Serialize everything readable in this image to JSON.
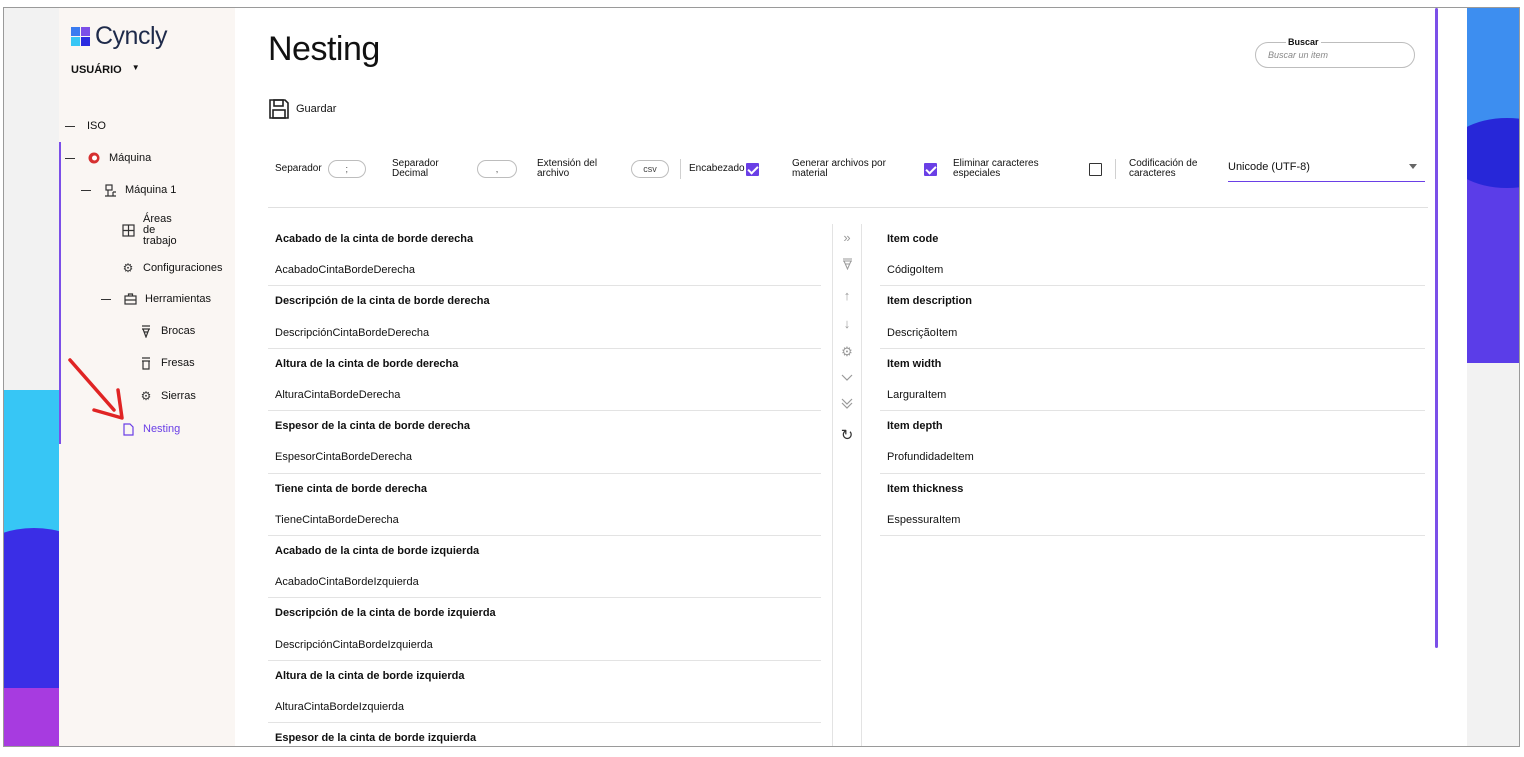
{
  "brand": {
    "name": "Cyncly"
  },
  "user": {
    "name": "USUÁRIO"
  },
  "sidebar": {
    "items": [
      {
        "label": "ISO",
        "icon": "dash"
      },
      {
        "label": "Máquina",
        "icon": "machine-logo-icon"
      },
      {
        "label": "Máquina 1",
        "icon": "machine-icon"
      },
      {
        "label": "Áreas de trabajo",
        "icon": "grid-icon"
      },
      {
        "label": "Configuraciones",
        "icon": "gear-icon"
      },
      {
        "label": "Herramientas",
        "icon": "toolbox-icon"
      },
      {
        "label": "Brocas",
        "icon": "drill-bit-icon"
      },
      {
        "label": "Fresas",
        "icon": "mill-icon"
      },
      {
        "label": "Sierras",
        "icon": "saw-icon"
      },
      {
        "label": "Nesting",
        "icon": "file-icon"
      }
    ]
  },
  "page": {
    "title": "Nesting"
  },
  "search": {
    "label": "Buscar",
    "placeholder": "Buscar un item"
  },
  "toolbar": {
    "save_label": "Guardar",
    "separator_label": "Separador",
    "separator_value": ";",
    "decimal_label_1": "Separador",
    "decimal_label_2": "Decimal",
    "decimal_value": ",",
    "ext_label_1": "Extensión del",
    "ext_label_2": "archivo",
    "ext_value": "csv",
    "header_label": "Encabezado",
    "header_checked": true,
    "per_material_label_1": "Generar archivos por",
    "per_material_label_2": "material",
    "per_material_checked": true,
    "remove_special_label_1": "Eliminar caracteres",
    "remove_special_label_2": "especiales",
    "remove_special_checked": false,
    "encoding_label_1": "Codificación de",
    "encoding_label_2": "caracteres",
    "encoding_value": "Unicode (UTF-8)"
  },
  "left_fields": [
    {
      "title": "Acabado de la cinta de borde derecha",
      "code": "AcabadoCintaBordeDerecha"
    },
    {
      "title": "Descripción de la cinta de borde derecha",
      "code": "DescripciónCintaBordeDerecha"
    },
    {
      "title": "Altura de la cinta de borde derecha",
      "code": "AlturaCintaBordeDerecha"
    },
    {
      "title": "Espesor de la cinta de borde derecha",
      "code": "EspesorCintaBordeDerecha"
    },
    {
      "title": "Tiene cinta de borde derecha",
      "code": "TieneCintaBordeDerecha"
    },
    {
      "title": "Acabado de la cinta de borde izquierda",
      "code": "AcabadoCintaBordeIzquierda"
    },
    {
      "title": "Descripción de la cinta de borde izquierda",
      "code": "DescripciónCintaBordeIzquierda"
    },
    {
      "title": "Altura de la cinta de borde izquierda",
      "code": "AlturaCintaBordeIzquierda"
    },
    {
      "title": "Espesor de la cinta de borde izquierda",
      "code": ""
    }
  ],
  "right_fields": [
    {
      "title": "Item code",
      "code": "CódigoItem"
    },
    {
      "title": "Item description",
      "code": "DescriçãoItem"
    },
    {
      "title": "Item width",
      "code": "LarguraItem"
    },
    {
      "title": "Item depth",
      "code": "ProfundidadeItem"
    },
    {
      "title": "Item thickness",
      "code": "EspessuraItem"
    }
  ],
  "move_controls": [
    "move-all-right-icon",
    "move-all-left-icon",
    "move-up-icon",
    "move-down-icon",
    "settings-icon",
    "chevron-down-icon",
    "double-chevron-down-icon",
    "refresh-icon"
  ],
  "colors": {
    "accent": "#6a3fe6",
    "sidebar_bg": "#faf6f3"
  }
}
